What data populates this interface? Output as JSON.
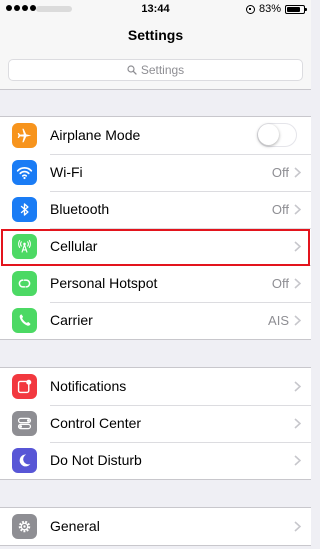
{
  "status_bar": {
    "time": "13:44",
    "battery": "83%",
    "battery_level": 0.83
  },
  "nav": {
    "title": "Settings"
  },
  "search": {
    "placeholder": "Settings"
  },
  "colors": {
    "airplane": "#f7941d",
    "wifi": "#1a7cf5",
    "bluetooth": "#1a7cf5",
    "cellular": "#4cd964",
    "hotspot": "#4cd964",
    "carrier": "#4cd964",
    "notifications": "#f2383f",
    "control_center": "#8e8e93",
    "do_not_disturb": "#5856d6",
    "general": "#8e8e93",
    "highlight": "#e3141d"
  },
  "groups": [
    {
      "items": [
        {
          "label": "Airplane Mode",
          "icon": "airplane-icon",
          "control": "toggle",
          "on": false
        },
        {
          "label": "Wi-Fi",
          "icon": "wifi-icon",
          "value": "Off"
        },
        {
          "label": "Bluetooth",
          "icon": "bluetooth-icon",
          "value": "Off"
        },
        {
          "label": "Cellular",
          "icon": "cellular-icon",
          "value": ""
        },
        {
          "label": "Personal Hotspot",
          "icon": "hotspot-icon",
          "value": "Off"
        },
        {
          "label": "Carrier",
          "icon": "carrier-icon",
          "value": "AIS"
        }
      ]
    },
    {
      "items": [
        {
          "label": "Notifications",
          "icon": "notifications-icon"
        },
        {
          "label": "Control Center",
          "icon": "control-center-icon"
        },
        {
          "label": "Do Not Disturb",
          "icon": "moon-icon"
        }
      ]
    },
    {
      "items": [
        {
          "label": "General",
          "icon": "gear-icon"
        }
      ]
    }
  ]
}
